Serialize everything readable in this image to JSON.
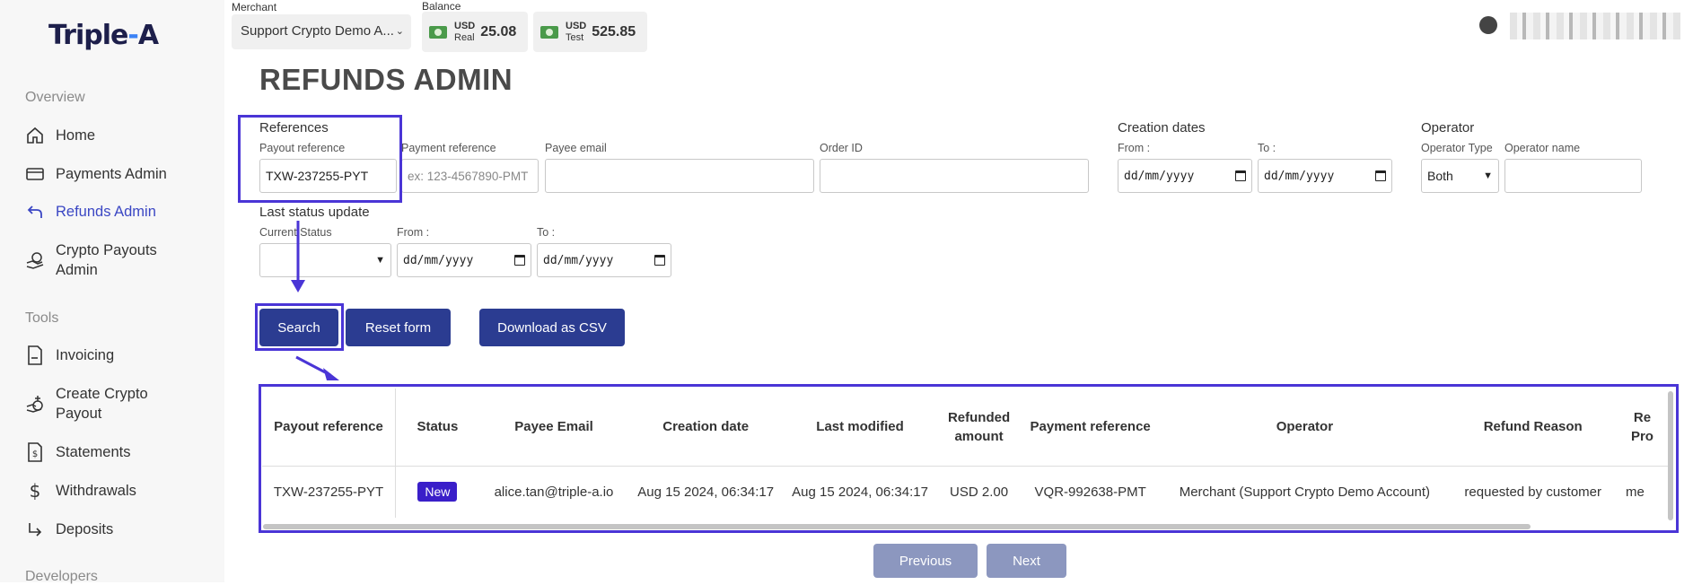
{
  "logo": {
    "part1": "Triple",
    "dash": "-",
    "part2": "A"
  },
  "sidebar": {
    "overview_title": "Overview",
    "tools_title": "Tools",
    "developers_title": "Developers",
    "items": [
      {
        "label": "Home"
      },
      {
        "label": "Payments Admin"
      },
      {
        "label": "Refunds Admin"
      },
      {
        "label": "Crypto Payouts Admin"
      },
      {
        "label": "Invoicing"
      },
      {
        "label": "Create Crypto Payout"
      },
      {
        "label": "Statements"
      },
      {
        "label": "Withdrawals"
      },
      {
        "label": "Deposits"
      }
    ]
  },
  "header": {
    "merchant_label": "Merchant",
    "merchant_value": "Support Crypto Demo A...",
    "balance_label": "Balance",
    "balances": [
      {
        "currency": "USD",
        "type": "Real",
        "amount": "25.08"
      },
      {
        "currency": "USD",
        "type": "Test",
        "amount": "525.85"
      }
    ]
  },
  "page_title": "REFUNDS ADMIN",
  "form": {
    "references_label": "References",
    "payout_ref_label": "Payout reference",
    "payout_ref_value": "TXW-237255-PYT",
    "payment_ref_label": "Payment reference",
    "payment_ref_placeholder": "ex: 123-4567890-PMT",
    "payee_email_label": "Payee email",
    "order_id_label": "Order ID",
    "creation_dates_label": "Creation dates",
    "from_label": "From :",
    "to_label": "To :",
    "date_placeholder": "dd/mm/yyyy",
    "operator_label": "Operator",
    "operator_type_label": "Operator Type",
    "operator_type_value": "Both",
    "operator_name_label": "Operator name",
    "last_status_label": "Last status update",
    "current_status_label": "Current Status"
  },
  "buttons": {
    "search": "Search",
    "reset": "Reset form",
    "download": "Download as CSV"
  },
  "table": {
    "headers": [
      "Payout reference",
      "Status",
      "Payee Email",
      "Creation date",
      "Last modified",
      "Refunded amount",
      "Payment reference",
      "Operator",
      "Refund Reason",
      "Re Pro"
    ],
    "row": {
      "payout_ref": "TXW-237255-PYT",
      "status": "New",
      "email": "alice.tan@triple-a.io",
      "created": "Aug 15 2024, 06:34:17",
      "modified": "Aug 15 2024, 06:34:17",
      "amount": "USD 2.00",
      "payment_ref": "VQR-992638-PMT",
      "operator": "Merchant (Support Crypto Demo Account)",
      "reason": "requested by customer",
      "extra": "me"
    }
  },
  "pagination": {
    "previous": "Previous",
    "next": "Next"
  },
  "colors": {
    "accent": "#3b47c4",
    "button": "#2b3c91",
    "highlight": "#4a35d6",
    "badge": "#3a1fc9"
  }
}
